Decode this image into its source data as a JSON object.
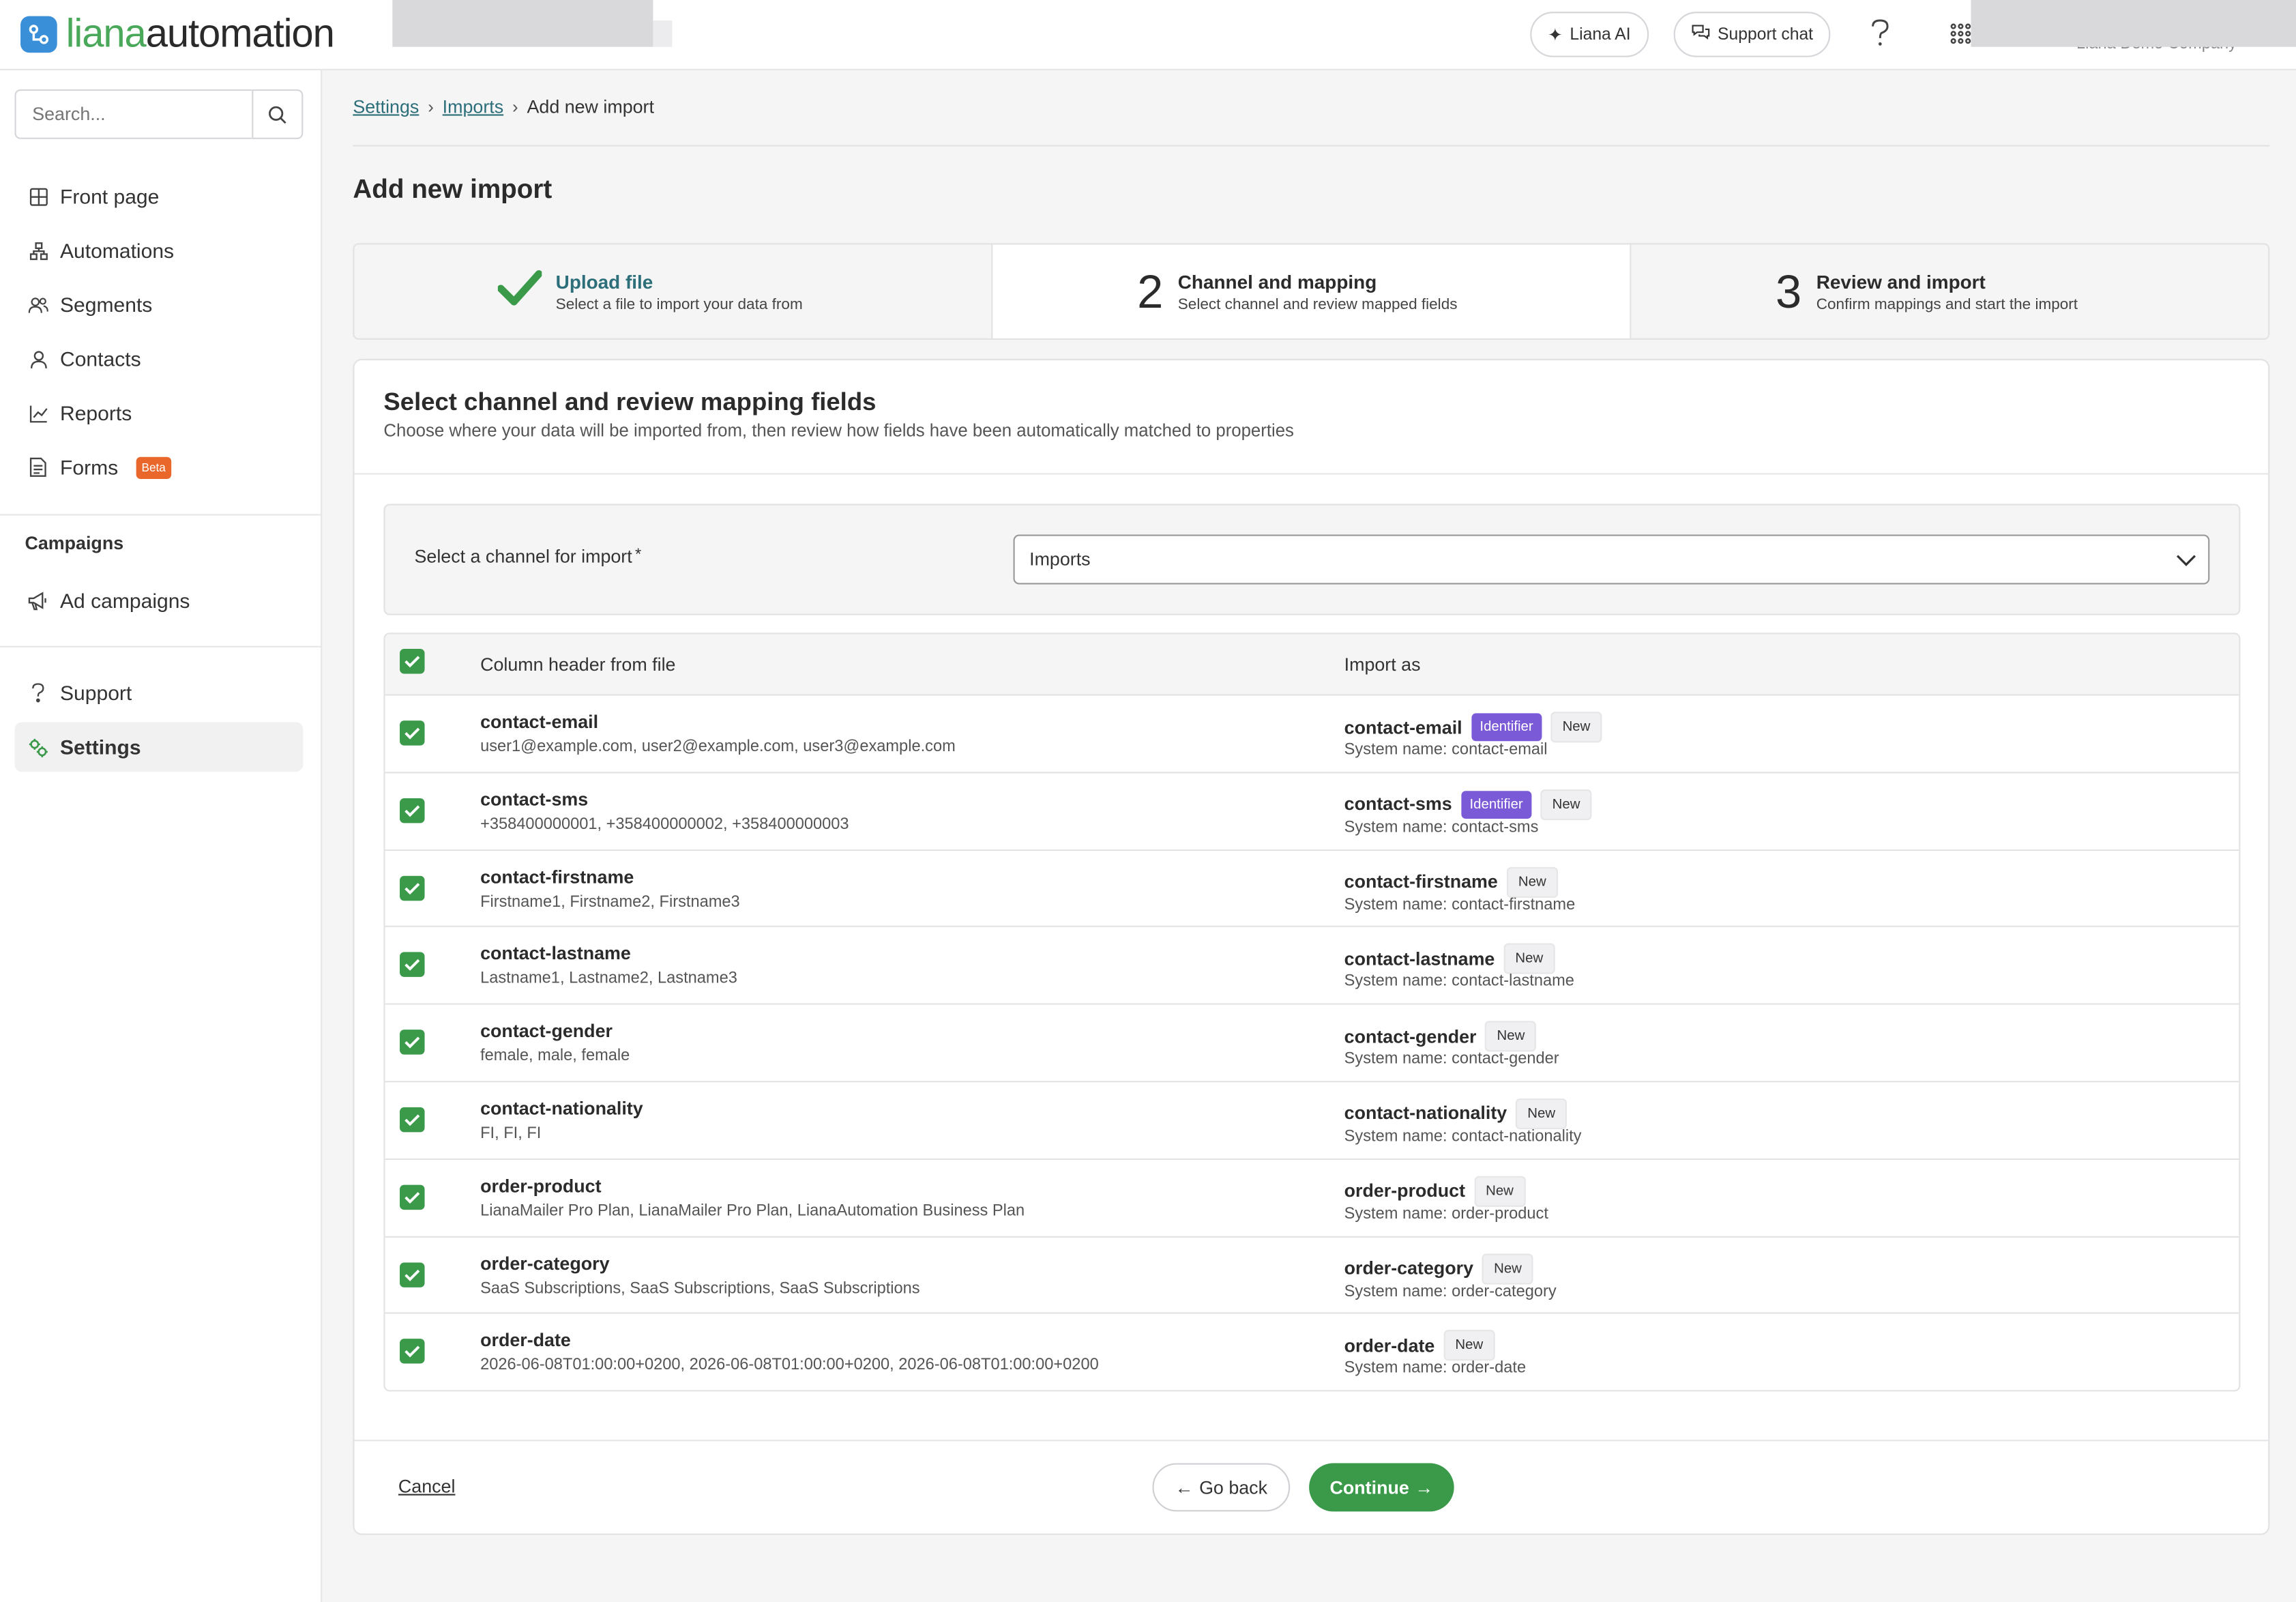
{
  "brand": {
    "logo_part1": "liana",
    "logo_part2": "automation",
    "accent": "#3a9a4a",
    "logo_mark_color": "#3a8fd9"
  },
  "topbar": {
    "ai_button": "Liana AI",
    "support_button": "Support chat",
    "company": "Liana Demo Company"
  },
  "sidebar": {
    "search_placeholder": "Search...",
    "items": [
      {
        "label": "Front page",
        "icon": "grid-icon"
      },
      {
        "label": "Automations",
        "icon": "flow-icon"
      },
      {
        "label": "Segments",
        "icon": "users-icon"
      },
      {
        "label": "Contacts",
        "icon": "user-icon"
      },
      {
        "label": "Reports",
        "icon": "chart-icon"
      },
      {
        "label": "Forms",
        "icon": "document-icon",
        "badge": "Beta"
      }
    ],
    "campaigns_heading": "Campaigns",
    "campaign_items": [
      {
        "label": "Ad campaigns",
        "icon": "megaphone-icon"
      }
    ],
    "bottom_items": [
      {
        "label": "Support",
        "icon": "question-icon"
      },
      {
        "label": "Settings",
        "icon": "settings-icon"
      }
    ]
  },
  "breadcrumb": [
    "Settings",
    "Imports",
    "Add new import"
  ],
  "page_title": "Add new import",
  "steps": [
    {
      "num": "",
      "title": "Upload file",
      "desc": "Select a file to import your data from",
      "state": "done"
    },
    {
      "num": "2",
      "title": "Channel and mapping",
      "desc": "Select channel and review mapped fields",
      "state": "current"
    },
    {
      "num": "3",
      "title": "Review and import",
      "desc": "Confirm mappings and start the import",
      "state": "pending"
    }
  ],
  "card": {
    "title": "Select channel and review mapping fields",
    "subtitle": "Choose where your data will be imported from, then review how fields have been automatically matched to properties",
    "channel_label": "Select a channel for import",
    "channel_required": "*",
    "channel_value": "Imports"
  },
  "table": {
    "col1": "Column header from file",
    "col2": "Import as",
    "rows": [
      {
        "name": "contact-email",
        "sample": "user1@example.com, user2@example.com, user3@example.com",
        "import": "contact-email",
        "identifier": "Identifier",
        "new": "New",
        "system": "System name: contact-email"
      },
      {
        "name": "contact-sms",
        "sample": "+358400000001, +358400000002, +358400000003",
        "import": "contact-sms",
        "identifier": "Identifier",
        "new": "New",
        "system": "System name: contact-sms"
      },
      {
        "name": "contact-firstname",
        "sample": "Firstname1, Firstname2, Firstname3",
        "import": "contact-firstname",
        "identifier": "",
        "new": "New",
        "system": "System name: contact-firstname"
      },
      {
        "name": "contact-lastname",
        "sample": "Lastname1, Lastname2, Lastname3",
        "import": "contact-lastname",
        "identifier": "",
        "new": "New",
        "system": "System name: contact-lastname"
      },
      {
        "name": "contact-gender",
        "sample": "female, male, female",
        "import": "contact-gender",
        "identifier": "",
        "new": "New",
        "system": "System name: contact-gender"
      },
      {
        "name": "contact-nationality",
        "sample": "FI, FI, FI",
        "import": "contact-nationality",
        "identifier": "",
        "new": "New",
        "system": "System name: contact-nationality"
      },
      {
        "name": "order-product",
        "sample": "LianaMailer Pro Plan, LianaMailer Pro Plan, LianaAutomation Business Plan",
        "import": "order-product",
        "identifier": "",
        "new": "New",
        "system": "System name: order-product"
      },
      {
        "name": "order-category",
        "sample": "SaaS Subscriptions, SaaS Subscriptions, SaaS Subscriptions",
        "import": "order-category",
        "identifier": "",
        "new": "New",
        "system": "System name: order-category"
      },
      {
        "name": "order-date",
        "sample": "2026-06-08T01:00:00+0200, 2026-06-08T01:00:00+0200, 2026-06-08T01:00:00+0200",
        "import": "order-date",
        "identifier": "",
        "new": "New",
        "system": "System name: order-date"
      }
    ]
  },
  "footer": {
    "cancel": "Cancel",
    "back": "Go back",
    "continue": "Continue"
  }
}
